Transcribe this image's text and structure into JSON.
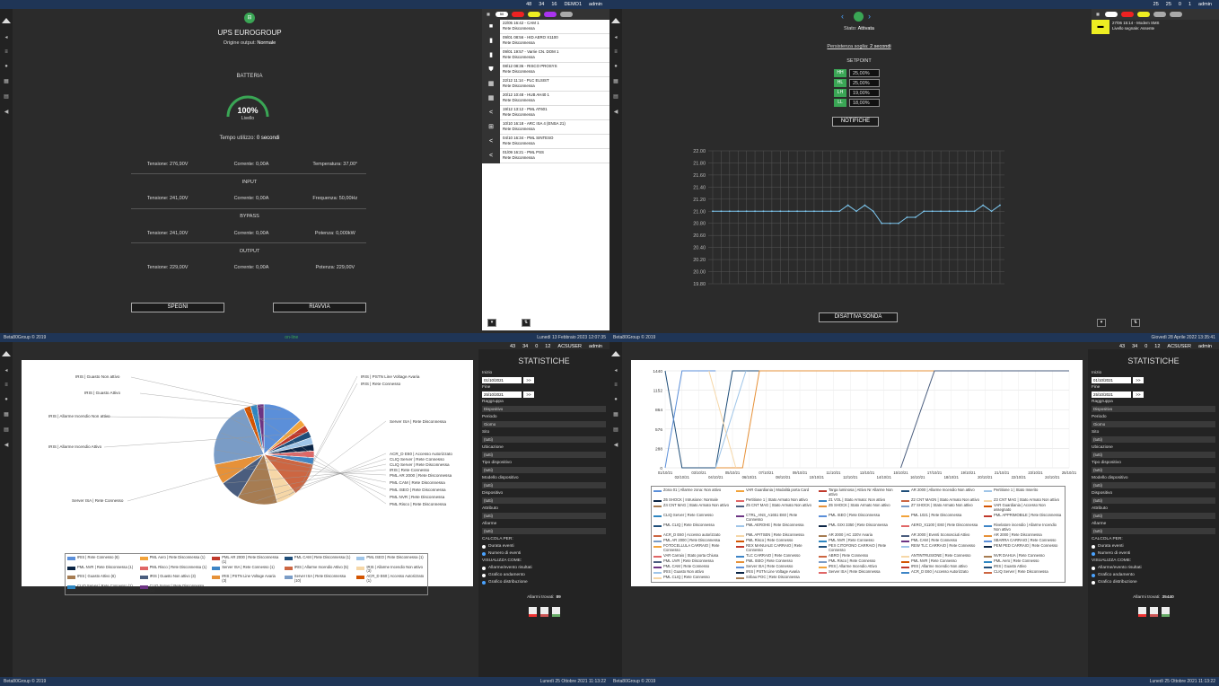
{
  "q1": {
    "top": {
      "a": "48",
      "b": "34",
      "c": "16",
      "user": "DEMO1",
      "admin": "admin"
    },
    "title": "UPS EUROGROUP",
    "origin_label": "Origine output:",
    "origin_value": "Normale",
    "battery_heading": "BATTERIA",
    "battery_pct": "100%",
    "battery_level_label": "Livello",
    "battery_fill": 1.0,
    "time_label": "Tempo utilizzo:",
    "time_value": "0 secondi",
    "row1": [
      "Tensione: 276,90V",
      "Corrente: 0,00A",
      "Temperatura: 37,00°"
    ],
    "input_heading": "INPUT",
    "row2": [
      "Tensione: 241,00V",
      "Corrente: 0,00A",
      "Frequenza: 50,00Hz"
    ],
    "bypass_heading": "BYPASS",
    "row3": [
      "Tensione: 241,00V",
      "Corrente: 0,00A",
      "Potenza: 0,000kW"
    ],
    "output_heading": "OUTPUT",
    "row4": [
      "Tensione: 229,00V",
      "Corrente: 0,00A",
      "Potenza: 229,00V"
    ],
    "btn_off": "SPEGNI",
    "btn_restart": "RIAVVIA",
    "footer_left": "Beta80Group © 2019",
    "footer_right": "Lunedì 13 Febbraio 2023 12:07:35",
    "events": [
      {
        "icon": "■",
        "l1": "22/05 16:42 - CAM 1",
        "l2": "Rete Disconnessa"
      },
      {
        "icon": "▮",
        "l1": "09/01 08:56 - HID AERO X1100",
        "l2": "Rete Disconnessa"
      },
      {
        "icon": "▮",
        "l1": "09/01 19:57 - Varrie CN. DOM 1",
        "l2": "Rete Disconnessa"
      },
      {
        "icon": "⛊",
        "l1": "08/12 08:36 - RISCO PROSYS",
        "l2": "Rete Disconnessa"
      },
      {
        "icon": "▦",
        "l1": "22/12 11:14 - PLC ELSIST",
        "l2": "Rete Disconnessa"
      },
      {
        "icon": "▦",
        "l1": "20/12 10:48 - HUB AH40 1",
        "l2": "Rete Disconnessa"
      },
      {
        "icon": "<",
        "l1": "19/12 13:12 - PML AT601",
        "l2": "Rete Disconnessa"
      },
      {
        "icon": "⊞",
        "l1": "10/10 16:18 - ARC ISA 4 (ENSA 21)",
        "l2": "Rete Disconnessa"
      },
      {
        "icon": "<",
        "l1": "04/10 16:34 - PML SINTESO",
        "l2": "Rete Disconnessa"
      },
      {
        "icon": "<",
        "l1": "01/09 16:21 - PML PSS",
        "l2": "Rete Disconnessa"
      }
    ],
    "tab_counts": [
      "50",
      "",
      "",
      "",
      ""
    ]
  },
  "q2": {
    "top": {
      "a": "25",
      "b": "25",
      "c": "0",
      "d": "1",
      "admin": "admin"
    },
    "status_label": "Stato:",
    "status_value": "Attivata",
    "persist_label": "Persistenza soglia:",
    "persist_value": "2 secondi",
    "setpoint_heading": "SETPOINT",
    "setpoints": [
      {
        "k": "HH",
        "v": "25,00%"
      },
      {
        "k": "HL",
        "v": "25,00%"
      },
      {
        "k": "LH",
        "v": "19,00%"
      },
      {
        "k": "LL",
        "v": "18,00%"
      }
    ],
    "btn_notify": "NOTIFICHE",
    "btn_disable": "DISATTIVA SONDA",
    "side_event": {
      "l1": "27/06 15:14 - Modem SMS",
      "l2": "Livello segnale: Assente"
    },
    "footer_right": "Giovedì 28 Aprile 2022 13:35:41"
  },
  "chart_data": {
    "type": "line",
    "ylim": [
      19.8,
      22.0
    ],
    "yticks": [
      "22.00",
      "21.80",
      "21.60",
      "21.40",
      "21.20",
      "21.00",
      "20.80",
      "20.60",
      "20.40",
      "20.20",
      "20.00",
      "19.80"
    ],
    "values": [
      21.0,
      21.0,
      21.0,
      21.0,
      21.0,
      21.0,
      21.0,
      21.0,
      21.0,
      21.0,
      21.0,
      21.0,
      21.0,
      21.0,
      21.0,
      21.0,
      21.1,
      21.0,
      21.1,
      21.0,
      20.8,
      20.8,
      20.8,
      20.9,
      20.9,
      21.0,
      21.0,
      21.0,
      21.0,
      21.0,
      21.0,
      21.0,
      21.1,
      21.0,
      21.1
    ]
  },
  "q3": {
    "top": {
      "status": "on-line",
      "datetime": "Lunedì 13 Febbraio 2023 12:07:35",
      "a": "43",
      "b": "34",
      "c": "0",
      "d": "12",
      "user": "ACSUSER",
      "admin": "admin"
    },
    "pie": [
      {
        "label": "IRIS | Rete Connesso (6)",
        "color": "#5b8fd9",
        "value": 6
      },
      {
        "label": "PML Aero | Rete Disconnessa (1)",
        "color": "#f2a33a",
        "value": 1
      },
      {
        "label": "PML AR 2000 | Rete Disconnessa (1)",
        "color": "#c0392b",
        "value": 1
      },
      {
        "label": "PML CAM | Rete Disconnessa (1)",
        "color": "#1f4e79",
        "value": 1
      },
      {
        "label": "PML ISEO | Rete Disconnessa (1)",
        "color": "#9fc5e8",
        "value": 1
      },
      {
        "label": "PML NVR | Rete Disconnessa (1)",
        "color": "#0b2545",
        "value": 1
      },
      {
        "label": "PML Risco | Rete Disconnessa (1)",
        "color": "#e06666",
        "value": 1
      },
      {
        "label": "Server ISA | Rete Connesso (1)",
        "color": "#3d85c6",
        "value": 1
      },
      {
        "label": "IRIS | Allarme Incendio Attivo (5)",
        "color": "#cc6642",
        "value": 5
      },
      {
        "label": "IRIS | Allarme Incendio Non attivo (3)",
        "color": "#f6d7a7",
        "value": 3
      },
      {
        "label": "IRIS | Guasto Attivo (6)",
        "color": "#a67c52",
        "value": 6
      },
      {
        "label": "IRIS | Guasto Non attivo (3)",
        "color": "#4a5d7e",
        "value": 3
      },
      {
        "label": "IRIS | PSTN Line Voltage Avaria (3)",
        "color": "#e69138",
        "value": 3
      },
      {
        "label": "Server ISA | Rete Disconnessa (10)",
        "color": "#7a9cc6",
        "value": 10
      },
      {
        "label": "ACR_D E60 | Accesso Autorizzato (1)",
        "color": "#d35400",
        "value": 1
      },
      {
        "label": "CLIQ Server | Rete Connesso (1)",
        "color": "#2e86c1",
        "value": 1
      },
      {
        "label": "CLIQ Server | Rete Disconnessa (1)",
        "color": "#6c3483",
        "value": 1
      }
    ],
    "callouts": [
      "IRIS | Guasto Non attivo",
      "IRIS | Guasto Attivo",
      "IRIS | Allarme Incendio Non attivo",
      "IRIS | Allarme Incendio Attivo",
      "Server ISA | Rete Connesso",
      "IRIS | PSTN Line Voltage Avaria",
      "IRIS | Rete Connesso",
      "Server ISA | Rete Disconnessa",
      "ACR_D E60 | Accesso Autorizzato",
      "CLIQ Server | Rete Connesso",
      "CLIQ Server | Rete Disconnessa",
      "IRIS | Rete Connesso",
      "PML AR 2000 | Rete Disconnessa",
      "PML CAM | Rete Disconnessa",
      "PML ISEO | Rete Disconnessa",
      "PML NVR | Rete Disconnessa",
      "PML Risco | Rete Disconnessa"
    ],
    "footer_left": "Beta80Group © 2019",
    "footer_right": "Lunedì 25 Ottobre 2021 11:13:22"
  },
  "stat3": {
    "title": "STATISTICHE",
    "inizio": "Inizio",
    "inizio_v": "01/10/2021",
    "fine": "Fine",
    "fine_v": "25/10/2021",
    "go": ">>",
    "fields": [
      {
        "l": "Raggruppa",
        "v": "Dispositivo"
      },
      {
        "l": "Periodo",
        "v": "Giorno"
      },
      {
        "l": "Sito",
        "v": "(tutti)"
      },
      {
        "l": "Ubicazione",
        "v": "(tutti)"
      },
      {
        "l": "Tipo dispositivo",
        "v": "(tutti)"
      },
      {
        "l": "Modello dispositivo",
        "v": "(tutti)"
      },
      {
        "l": "Dispositivo",
        "v": "(tutti)"
      },
      {
        "l": "Attributo",
        "v": "(tutti)"
      },
      {
        "l": "Allarme",
        "v": "(tutti)"
      }
    ],
    "calc": "CALCOLA PER:",
    "c1": "Durata eventi",
    "c2": "Numero di eventi",
    "vis": "VISUALIZZA COME:",
    "v1": "Allarme/evento risultati",
    "v2": "Grafico andamento",
    "v3": "Grafico distribuzione",
    "found_label": "Allarmi trovati:",
    "found": "89"
  },
  "q4": {
    "top": {
      "a": "43",
      "b": "34",
      "c": "0",
      "d": "12",
      "user": "ACSUSER",
      "admin": "admin"
    },
    "yticks": [
      "1440",
      "1152",
      "864",
      "576",
      "288",
      "0"
    ],
    "xticks": [
      "01/10/21",
      "02/10/21",
      "03/10/21",
      "04/10/21",
      "05/10/21",
      "06/10/21",
      "07/10/21",
      "08/10/21",
      "09/10/21",
      "10/10/21",
      "11/10/21",
      "12/10/21",
      "13/10/21",
      "14/10/21",
      "15/10/21",
      "16/10/21",
      "17/10/21",
      "18/10/21",
      "19/10/21",
      "20/10/21",
      "21/10/21",
      "22/10/21",
      "23/10/21",
      "24/10/21",
      "25/10/21"
    ],
    "series": [
      {
        "name": "Zona 01 | Allarme zona: Non attivo",
        "color": "#5b8fd9"
      },
      {
        "name": "VAR Guardiania | Modalità porta Card",
        "color": "#f2a33a"
      },
      {
        "name": "Targa luminosa | Attivo Nr Allarme Non attivo",
        "color": "#c0392b"
      },
      {
        "name": "AR 2000 | Allarme Incendio Non attivo",
        "color": "#1f4e79"
      },
      {
        "name": "Pertitione 1 | Stato Inserito",
        "color": "#9fc5e8"
      },
      {
        "name": "Z6 SHOCK | Intrusione: Normale",
        "color": "#0b2545"
      },
      {
        "name": "Pertitione 1 | Stato Armato Non attivo",
        "color": "#e06666"
      },
      {
        "name": "Z1 VOL | Stato Armato: Non attivo",
        "color": "#3d85c6"
      },
      {
        "name": "Z2 CNT MAGN | Stato Armato Non attivo",
        "color": "#cc6642"
      },
      {
        "name": "Z3 CNT MAG | Stato Armato Non attivo",
        "color": "#f6d7a7"
      },
      {
        "name": "Z4 CNT MAG | Stato Armato Non attivo",
        "color": "#a67c52"
      },
      {
        "name": "Z5 CNT MAG | Stato Armato Non attivo",
        "color": "#4a5d7e"
      },
      {
        "name": "Z6 SHOCK | Stato Armato Non attivo",
        "color": "#e69138"
      },
      {
        "name": "Z7 SHOCK | Stato Armato Non attivo",
        "color": "#7a9cc6"
      },
      {
        "name": "VAR Guardiania | Accesso Non assegnato",
        "color": "#d35400"
      },
      {
        "name": "CLIQ Server | Rete Connesso",
        "color": "#2e86c1"
      },
      {
        "name": "CTRL_ANS_A1651 E60 | Rete Connesso",
        "color": "#6c3483"
      },
      {
        "name": "PML ISEO | Rete Disconnessa",
        "color": "#5b8fd9"
      },
      {
        "name": "PML 1021 | Rete Disconnessa",
        "color": "#f2a33a"
      },
      {
        "name": "PML APPRIMOBILE | Rete Disconnessa",
        "color": "#c0392b"
      },
      {
        "name": "PML CLIQ | Rete Disconnessa",
        "color": "#1f4e79"
      },
      {
        "name": "PML AEROHE | Rete Disconnessa",
        "color": "#9fc5e8"
      },
      {
        "name": "PML GIXI 3350 | Rete Disconnessa",
        "color": "#0b2545"
      },
      {
        "name": "AERO_X1100 | E60 | Rete Disconnessa",
        "color": "#e06666"
      },
      {
        "name": "Rivelatore incendio | Allarme Incendio Non attivo",
        "color": "#3d85c6"
      },
      {
        "name": "ACR_D E60 | Accesso autorizzato",
        "color": "#cc6642"
      },
      {
        "name": "PML APITSEN | Rete Disconnessa",
        "color": "#f6d7a7"
      },
      {
        "name": "AR 2000 | AC 220V Avaria",
        "color": "#a67c52"
      },
      {
        "name": "AR 2000 | Eventi Sconosciuti Attivo",
        "color": "#4a5d7e"
      },
      {
        "name": "AR 2000 | Rete Disconnessa",
        "color": "#e69138"
      },
      {
        "name": "PML AR 2000 | Rete Disconnessa",
        "color": "#7a9cc6"
      },
      {
        "name": "PML Risco | Rete Connesso",
        "color": "#d35400"
      },
      {
        "name": "PML NVR | Rete Connesso",
        "color": "#2e86c1"
      },
      {
        "name": "PML CAM | Rete Connesso",
        "color": "#6c3483"
      },
      {
        "name": "SBARRA CARRAIO | Rete Connesso",
        "color": "#5b8fd9"
      },
      {
        "name": "FOTOCELLULA CARRAIO | Rete Connesso",
        "color": "#f2a33a"
      },
      {
        "name": "REX MANUALE CARRAIO | Rete Connesso",
        "color": "#c0392b"
      },
      {
        "name": "PEX CITOFONO CARRAIO | Rete Connesso",
        "color": "#1f4e79"
      },
      {
        "name": "REW TLC CARRAIO | Rete Connesso",
        "color": "#9fc5e8"
      },
      {
        "name": "PEM PED CARRAIO | Rete Connesso",
        "color": "#0b2545"
      },
      {
        "name": "VAR Carraio | Stato porta Chiusa",
        "color": "#e06666"
      },
      {
        "name": "TLC CARRAIO | Rete Connesso",
        "color": "#3d85c6"
      },
      {
        "name": "ABRO | Rete Connesso",
        "color": "#cc6642"
      },
      {
        "name": "ANTINTRUSIONE | Rete Connesso",
        "color": "#f6d7a7"
      },
      {
        "name": "NVR DAHUA | Rete Connesso",
        "color": "#a67c52"
      },
      {
        "name": "PML UVR | Rete Disconnessa",
        "color": "#4a5d7e"
      },
      {
        "name": "PML ISEO | Rete Connesso",
        "color": "#e69138"
      },
      {
        "name": "PML Risco | Rete Connesso",
        "color": "#7a9cc6"
      },
      {
        "name": "PML NVR | Rete Connesso",
        "color": "#d35400"
      },
      {
        "name": "PML Aero | Rete Connesso",
        "color": "#2e86c1"
      },
      {
        "name": "PML CAM | Rete Connesso",
        "color": "#6c3483"
      },
      {
        "name": "Server ISA | Rete Connesso",
        "color": "#5b8fd9"
      },
      {
        "name": "IRIS | Allarme Incendio Attivo",
        "color": "#f2a33a"
      },
      {
        "name": "IRIS | Allarme Incendio Non attivo",
        "color": "#c0392b"
      },
      {
        "name": "IRIS | Guasto Attivo",
        "color": "#1f4e79"
      },
      {
        "name": "IRIS | Guasto Non attivo",
        "color": "#9fc5e8"
      },
      {
        "name": "IRIS | PSTN Line Voltage Avaria",
        "color": "#0b2545"
      },
      {
        "name": "Server ISA | Rete Disconnessa",
        "color": "#e06666"
      },
      {
        "name": "ACR_D E60 | Accesso Autorizzato",
        "color": "#3d85c6"
      },
      {
        "name": "CLIQ Server | Rete Disconnessa",
        "color": "#cc6642"
      },
      {
        "name": "PML CLIQ | Rete Connesso",
        "color": "#f6d7a7"
      },
      {
        "name": "Sirbau POC | Rete Disconnessa",
        "color": "#a67c52"
      }
    ],
    "footer_left": "Beta80Group © 2019",
    "footer_right": "Lunedì 25 Ottobre 2021 11:13:22"
  },
  "stat4": {
    "title": "STATISTICHE",
    "inizio": "Inizio",
    "inizio_v": "01/10/2021",
    "fine": "Fine",
    "fine_v": "25/10/2021",
    "go": ">>",
    "fields": [
      {
        "l": "Raggruppa",
        "v": "Dispositivo"
      },
      {
        "l": "Periodo",
        "v": "Giorno"
      },
      {
        "l": "Sito",
        "v": "(tutti)"
      },
      {
        "l": "Ubicazione",
        "v": "(tutti)"
      },
      {
        "l": "Tipo dispositivo",
        "v": "(tutti)"
      },
      {
        "l": "Modello dispositivo",
        "v": "(tutti)"
      },
      {
        "l": "Dispositivo",
        "v": "(tutti)"
      },
      {
        "l": "Attributo",
        "v": "(tutti)"
      },
      {
        "l": "Allarme",
        "v": "(tutti)"
      }
    ],
    "calc": "CALCOLA PER:",
    "c1": "Durata eventi",
    "c2": "Numero di eventi",
    "vis": "VISUALIZZA COME:",
    "v1": "Allarme/evento risultati",
    "v2": "Grafico andamento",
    "v3": "Grafico distribuzione",
    "found_label": "Allarmi trovati:",
    "found": "35440"
  }
}
